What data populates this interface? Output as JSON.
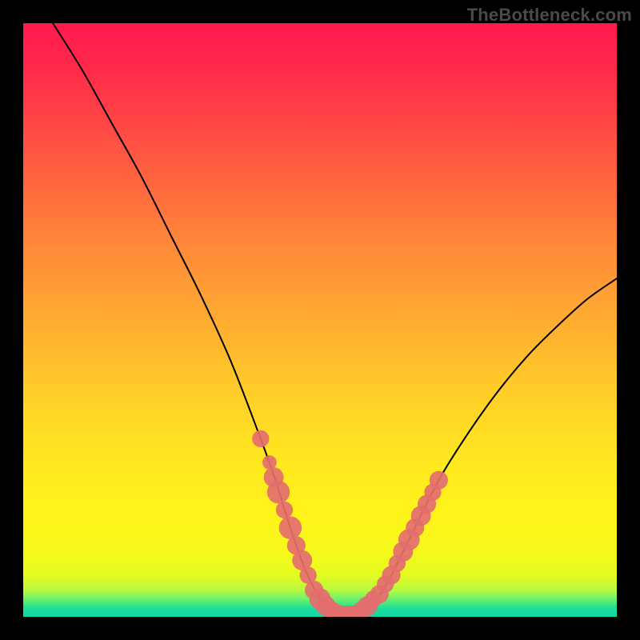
{
  "watermark": {
    "text": "TheBottleneck.com"
  },
  "chart_data": {
    "type": "line",
    "title": "",
    "xlabel": "",
    "ylabel": "",
    "xlim": [
      0,
      100
    ],
    "ylim": [
      0,
      100
    ],
    "grid": false,
    "legend": false,
    "background_gradient": [
      "#ff1a4d",
      "#ff8a38",
      "#ffe820",
      "#10d9a6"
    ],
    "series": [
      {
        "name": "bottleneck-curve",
        "stroke": "#000000",
        "x": [
          5,
          10,
          15,
          20,
          25,
          30,
          35,
          40,
          42.5,
          45,
          47.5,
          50,
          52,
          54,
          56,
          58,
          60,
          62,
          65,
          70,
          75,
          80,
          85,
          90,
          95,
          100
        ],
        "y": [
          100,
          92,
          83,
          74,
          64,
          54,
          43,
          30,
          23,
          15,
          8,
          3,
          1,
          0.2,
          0.2,
          1,
          3.5,
          7,
          13,
          23,
          31,
          38,
          44,
          49,
          53.5,
          57
        ]
      }
    ],
    "markers": [
      {
        "name": "dots",
        "fill": "#e46e6e",
        "points": [
          {
            "x": 40.0,
            "y": 30.0,
            "r": 1.2
          },
          {
            "x": 41.5,
            "y": 26.0,
            "r": 1.0
          },
          {
            "x": 42.2,
            "y": 23.5,
            "r": 1.4
          },
          {
            "x": 43.0,
            "y": 21.0,
            "r": 1.6
          },
          {
            "x": 44.0,
            "y": 18.0,
            "r": 1.2
          },
          {
            "x": 45.0,
            "y": 15.0,
            "r": 1.6
          },
          {
            "x": 46.0,
            "y": 12.0,
            "r": 1.3
          },
          {
            "x": 47.0,
            "y": 9.5,
            "r": 1.4
          },
          {
            "x": 48.0,
            "y": 7.0,
            "r": 1.2
          },
          {
            "x": 49.0,
            "y": 4.5,
            "r": 1.3
          },
          {
            "x": 50.0,
            "y": 3.0,
            "r": 1.5
          },
          {
            "x": 51.0,
            "y": 1.8,
            "r": 1.4
          },
          {
            "x": 52.0,
            "y": 1.0,
            "r": 1.3
          },
          {
            "x": 53.0,
            "y": 0.5,
            "r": 1.3
          },
          {
            "x": 54.0,
            "y": 0.2,
            "r": 1.4
          },
          {
            "x": 55.0,
            "y": 0.2,
            "r": 1.4
          },
          {
            "x": 56.0,
            "y": 0.4,
            "r": 1.3
          },
          {
            "x": 57.0,
            "y": 1.0,
            "r": 1.3
          },
          {
            "x": 58.0,
            "y": 1.8,
            "r": 1.4
          },
          {
            "x": 59.0,
            "y": 3.0,
            "r": 1.2
          },
          {
            "x": 60.0,
            "y": 3.8,
            "r": 1.3
          },
          {
            "x": 61.0,
            "y": 5.5,
            "r": 1.2
          },
          {
            "x": 62.0,
            "y": 7.0,
            "r": 1.3
          },
          {
            "x": 63.0,
            "y": 9.0,
            "r": 1.2
          },
          {
            "x": 64.0,
            "y": 11.0,
            "r": 1.4
          },
          {
            "x": 65.0,
            "y": 13.0,
            "r": 1.5
          },
          {
            "x": 66.0,
            "y": 15.0,
            "r": 1.3
          },
          {
            "x": 67.0,
            "y": 17.0,
            "r": 1.4
          },
          {
            "x": 68.0,
            "y": 19.0,
            "r": 1.3
          },
          {
            "x": 69.0,
            "y": 21.0,
            "r": 1.2
          },
          {
            "x": 70.0,
            "y": 23.0,
            "r": 1.3
          }
        ]
      }
    ]
  }
}
